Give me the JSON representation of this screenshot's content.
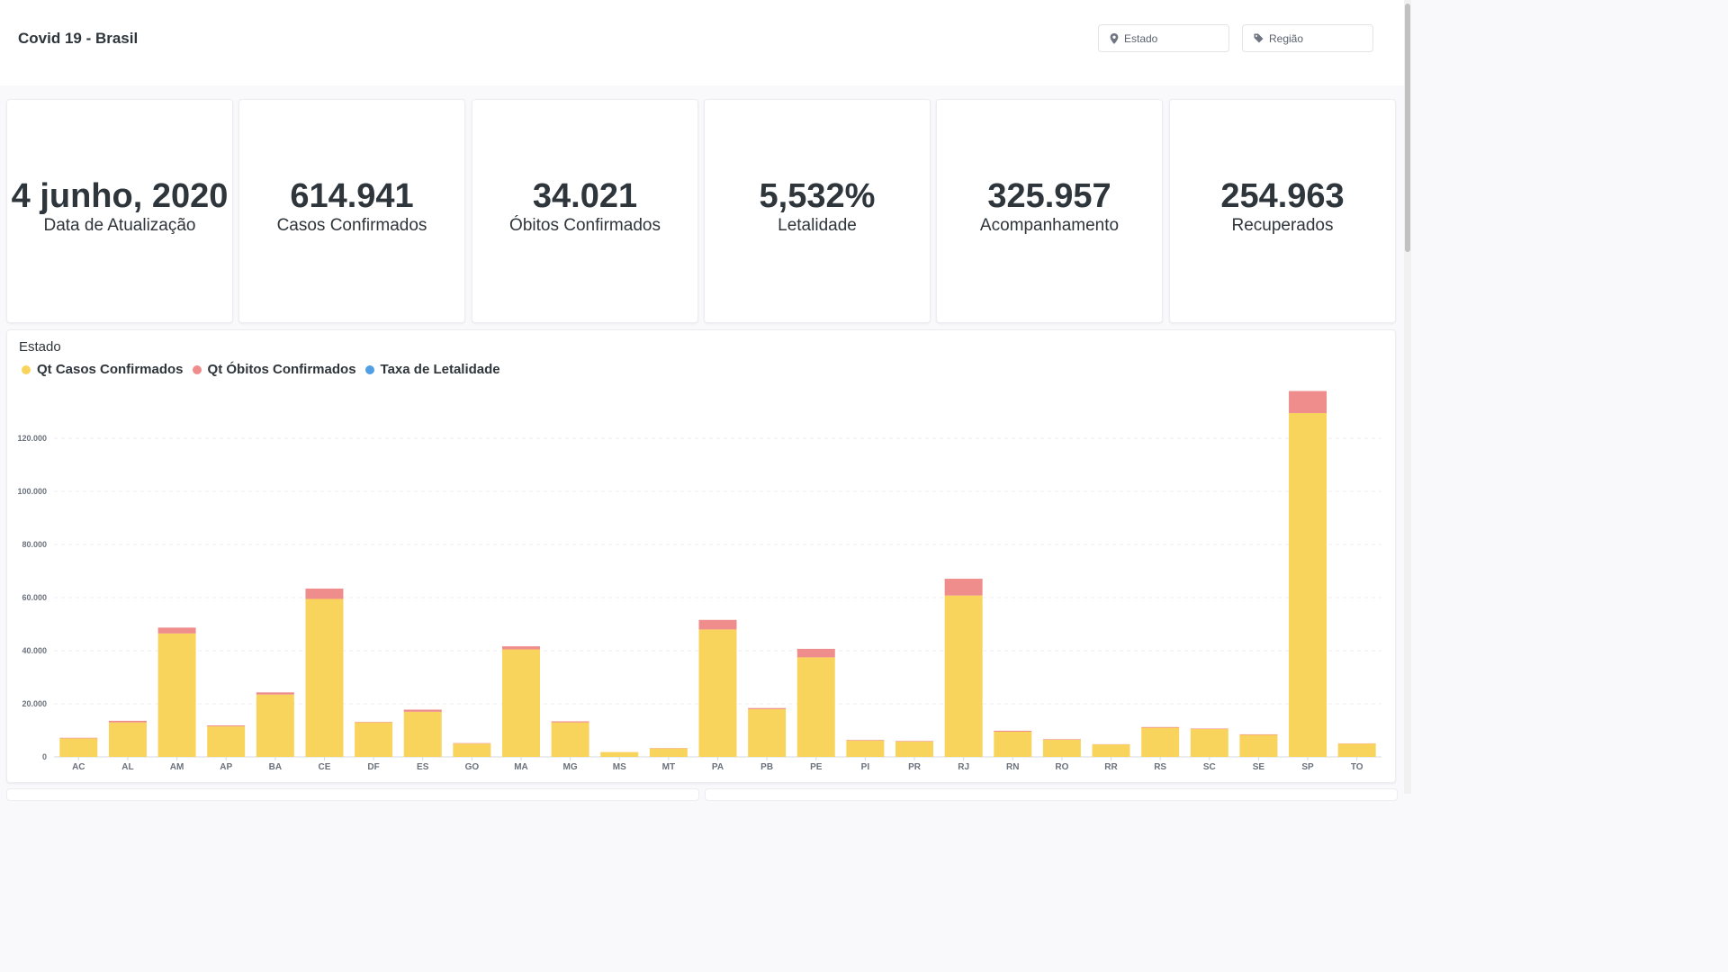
{
  "header": {
    "title": "Covid 19 - Brasil",
    "filters": [
      {
        "label": "Estado",
        "icon": "location-pin-icon"
      },
      {
        "label": "Região",
        "icon": "tag-icon"
      }
    ]
  },
  "cards": [
    {
      "value": "4 junho, 2020",
      "label": "Data de Atualização"
    },
    {
      "value": "614.941",
      "label": "Casos Confirmados"
    },
    {
      "value": "34.021",
      "label": "Óbitos Confirmados"
    },
    {
      "value": "5,532%",
      "label": "Letalidade"
    },
    {
      "value": "325.957",
      "label": "Acompanhamento"
    },
    {
      "value": "254.963",
      "label": "Recuperados"
    }
  ],
  "chart_panel": {
    "title": "Estado",
    "legend": [
      {
        "label": "Qt Casos Confirmados",
        "color": "#f9d45c"
      },
      {
        "label": "Qt Óbitos Confirmados",
        "color": "#ef8c8c"
      },
      {
        "label": "Taxa de Letalidade",
        "color": "#509ee3"
      }
    ]
  },
  "chart_data": {
    "type": "bar",
    "stacked": true,
    "categories": [
      "AC",
      "AL",
      "AM",
      "AP",
      "BA",
      "CE",
      "DF",
      "ES",
      "GO",
      "MA",
      "MG",
      "MS",
      "MT",
      "PA",
      "PB",
      "PE",
      "PI",
      "PR",
      "RJ",
      "RN",
      "RO",
      "RR",
      "RS",
      "SC",
      "SE",
      "SP",
      "TO"
    ],
    "series": [
      {
        "name": "Qt Casos Confirmados",
        "color": "#f9d45c",
        "values": [
          7000,
          13000,
          46500,
          11500,
          23500,
          59500,
          13000,
          17000,
          5000,
          40500,
          13000,
          1800,
          3200,
          48000,
          18000,
          37500,
          6200,
          5800,
          60800,
          9500,
          6500,
          4700,
          11000,
          10500,
          8300,
          129500,
          5000
        ]
      },
      {
        "name": "Qt Óbitos Confirmados",
        "color": "#ef8c8c",
        "values": [
          200,
          600,
          2200,
          350,
          800,
          3900,
          180,
          800,
          180,
          1150,
          400,
          20,
          120,
          3600,
          400,
          3200,
          200,
          200,
          6300,
          350,
          200,
          80,
          250,
          180,
          200,
          8300,
          100
        ]
      },
      {
        "name": "Taxa de Letalidade",
        "color": "#509ee3",
        "values": []
      }
    ],
    "yticks": [
      "0",
      "20.000",
      "40.000",
      "60.000",
      "80.000",
      "100.000",
      "120.000"
    ],
    "ylim": [
      0,
      138000
    ],
    "grid": true,
    "legend_position": "top-left"
  }
}
